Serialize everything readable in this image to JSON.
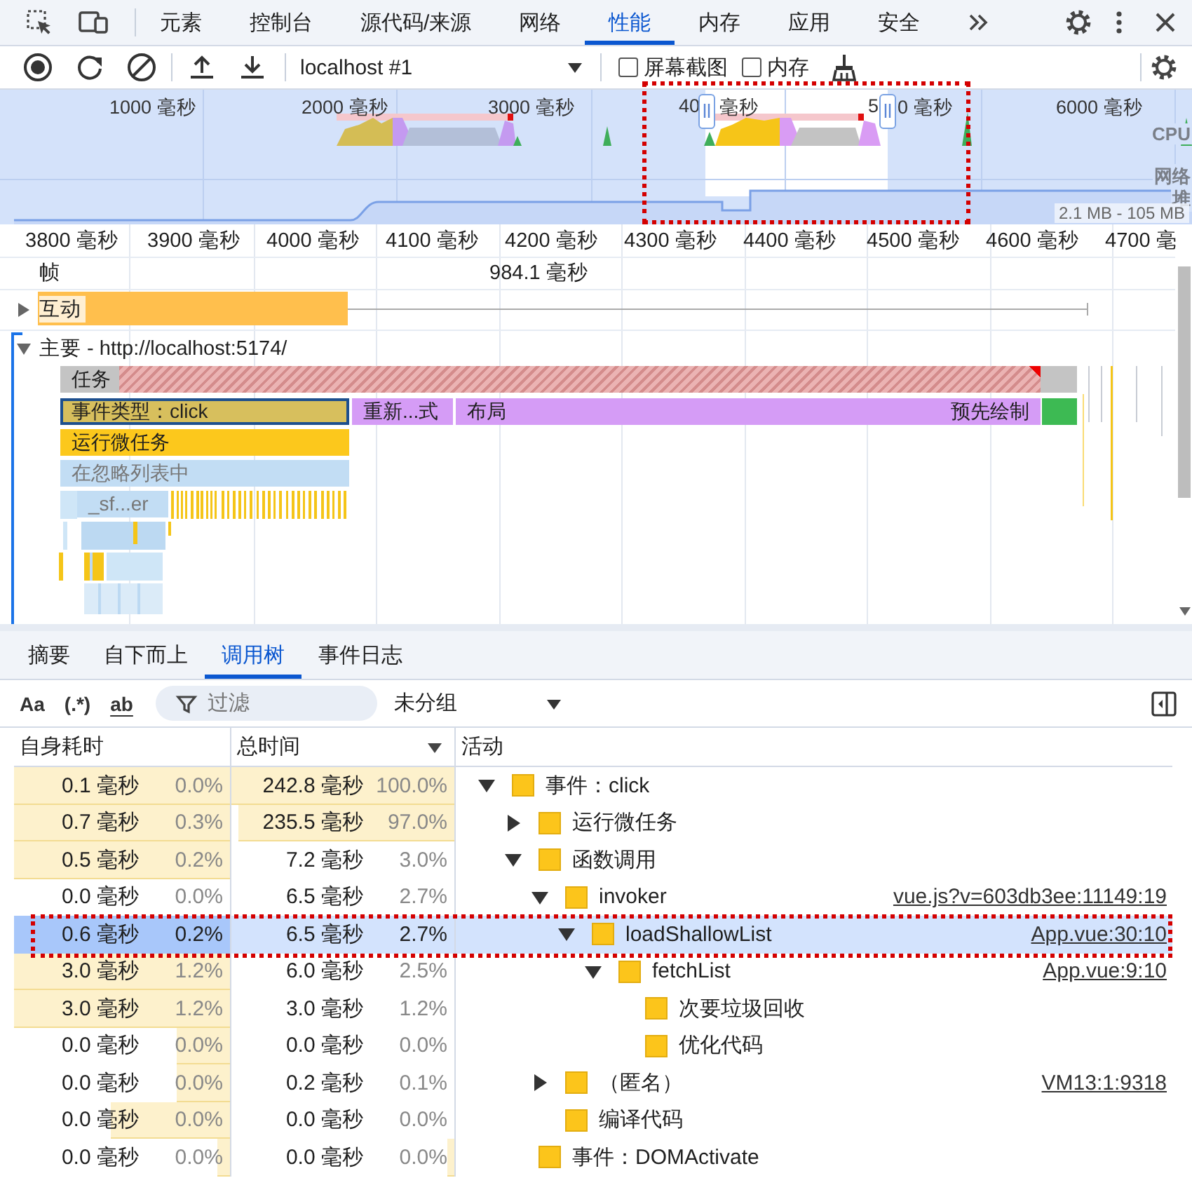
{
  "tabs": [
    {
      "label": "元素",
      "selected": false
    },
    {
      "label": "控制台",
      "selected": false
    },
    {
      "label": "源代码/来源",
      "selected": false
    },
    {
      "label": "网络",
      "selected": false
    },
    {
      "label": "性能",
      "selected": true
    },
    {
      "label": "内存",
      "selected": false
    },
    {
      "label": "应用",
      "selected": false
    },
    {
      "label": "安全",
      "selected": false
    }
  ],
  "toolbar": {
    "target": "localhost #1",
    "options": [
      {
        "label": "屏幕截图",
        "checked": false
      },
      {
        "label": "内存",
        "checked": false
      }
    ]
  },
  "overview": {
    "ticks": [
      "1000 毫秒",
      "2000 毫秒",
      "3000 毫秒",
      "40",
      "毫秒",
      "5",
      "0 毫秒",
      "6000 毫秒"
    ],
    "lanes": [
      "CPU",
      "网络",
      "堆"
    ],
    "heap_range": "2.1 MB - 105 MB"
  },
  "ruler": [
    "3800 毫秒",
    "3900 毫秒",
    "4000 毫秒",
    "4100 毫秒",
    "4200 毫秒",
    "4300 毫秒",
    "4400 毫秒",
    "4500 毫秒",
    "4600 毫秒",
    "4700 毫"
  ],
  "frames": {
    "label": "帧",
    "duration": "984.1 毫秒"
  },
  "tracks": [
    {
      "label": "互动",
      "expanded": false
    },
    {
      "label": "主要 - http://localhost:5174/",
      "expanded": true
    }
  ],
  "flame": [
    {
      "label": "任务",
      "kind": "task",
      "selected": false
    },
    {
      "kind": "other",
      "selected": false
    },
    {
      "label": "事件类型：click",
      "kind": "event",
      "selected": true
    },
    {
      "label": "重新...式",
      "kind": "rendering",
      "selected": false
    },
    {
      "label": "布局",
      "kind": "rendering",
      "selected": false
    },
    {
      "label": "预先绘制",
      "kind": "rendering",
      "selected": false
    },
    {
      "kind": "painting",
      "selected": false
    },
    {
      "label": "运行微任务",
      "kind": "scripting",
      "selected": false
    },
    {
      "label": "在忽略列表中",
      "kind": "ignored",
      "selected": false
    },
    {
      "label": "_sf...er",
      "kind": "ignored",
      "selected": false
    }
  ],
  "detail_tabs": [
    {
      "label": "摘要",
      "selected": false
    },
    {
      "label": "自下而上",
      "selected": false
    },
    {
      "label": "调用树",
      "selected": true
    },
    {
      "label": "事件日志",
      "selected": false
    }
  ],
  "filter": {
    "toggles": [
      "Aa",
      "(.*)",
      "ab"
    ],
    "placeholder": "过滤",
    "grouping": "未分组"
  },
  "table": {
    "columns": [
      "自身耗时",
      "总时间",
      "活动"
    ],
    "rows": [
      {
        "activity": "事件：click",
        "expanded": true,
        "selected": false,
        "self": {
          "time": "0.1 毫秒",
          "percent": "0.0%",
          "level": 1
        },
        "total": {
          "time": "242.8 毫秒",
          "percent": "100.0%",
          "level": 1
        },
        "children": [
          {
            "activity": "运行微任务",
            "expanded": false,
            "selected": false,
            "self": {
              "time": "0.7 毫秒",
              "percent": "0.3%",
              "level": 1
            },
            "total": {
              "time": "235.5 毫秒",
              "percent": "97.0%",
              "level": 0.97
            }
          },
          {
            "activity": "函数调用",
            "expanded": true,
            "selected": false,
            "self": {
              "time": "0.5 毫秒",
              "percent": "0.2%",
              "level": 1
            },
            "total": {
              "time": "7.2 毫秒",
              "percent": "3.0%"
            },
            "children": [
              {
                "activity": "invoker",
                "expanded": true,
                "selected": false,
                "source": "vue.js?v=603db3ee:11149:19",
                "self": {
                  "time": "0.0 毫秒",
                  "percent": "0.0%"
                },
                "total": {
                  "time": "6.5 毫秒",
                  "percent": "2.7%"
                },
                "children": [
                  {
                    "activity": "loadShallowList",
                    "expanded": true,
                    "selected": true,
                    "source": "App.vue:30:10",
                    "self": {
                      "time": "0.6 毫秒",
                      "percent": "0.2%",
                      "level": 1
                    },
                    "total": {
                      "time": "6.5 毫秒",
                      "percent": "2.7%"
                    },
                    "children": [
                      {
                        "activity": "fetchList",
                        "expanded": true,
                        "selected": false,
                        "source": "App.vue:9:10",
                        "self": {
                          "time": "3.0 毫秒",
                          "percent": "1.2%",
                          "level": 1
                        },
                        "total": {
                          "time": "6.0 毫秒",
                          "percent": "2.5%"
                        },
                        "children": [
                          {
                            "activity": "次要垃圾回收",
                            "selected": false,
                            "self": {
                              "time": "3.0 毫秒",
                              "percent": "1.2%",
                              "level": 1
                            },
                            "total": {
                              "time": "3.0 毫秒",
                              "percent": "1.2%"
                            }
                          },
                          {
                            "activity": "优化代码",
                            "selected": false,
                            "self": {
                              "time": "0.0 毫秒",
                              "percent": "0.0%",
                              "level": 0.25
                            },
                            "total": {
                              "time": "0.0 毫秒",
                              "percent": "0.0%"
                            }
                          }
                        ]
                      }
                    ]
                  }
                ]
              },
              {
                "activity": "（匿名）",
                "expanded": false,
                "selected": false,
                "source": "VM13:1:9318",
                "self": {
                  "time": "0.0 毫秒",
                  "percent": "0.0%",
                  "level": 0.25
                },
                "total": {
                  "time": "0.2 毫秒",
                  "percent": "0.1%"
                }
              },
              {
                "activity": "编译代码",
                "selected": false,
                "self": {
                  "time": "0.0 毫秒",
                  "percent": "0.0%",
                  "level": 0.55
                },
                "total": {
                  "time": "0.0 毫秒",
                  "percent": "0.0%"
                }
              }
            ]
          },
          {
            "activity": "事件：DOMActivate",
            "selected": false,
            "self": {
              "time": "0.0 毫秒",
              "percent": "0.0%",
              "level": 0.06
            },
            "total": {
              "time": "0.0 毫秒",
              "percent": "0.0%",
              "level": 0.03
            }
          }
        ]
      }
    ]
  },
  "annotations": [
    {
      "kind": "dotted-box"
    },
    {
      "kind": "dotted-box"
    }
  ]
}
